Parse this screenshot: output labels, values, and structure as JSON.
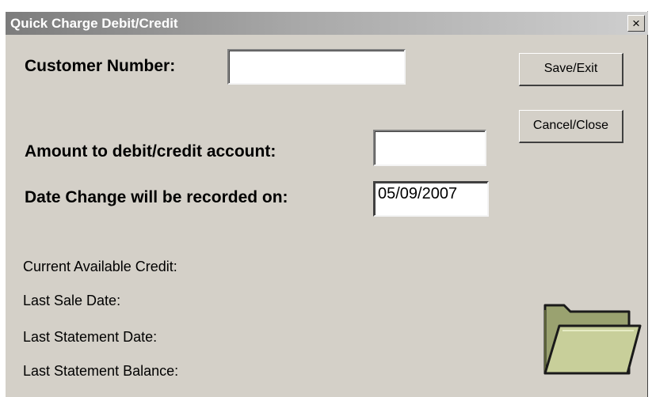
{
  "window": {
    "title": "Quick Charge Debit/Credit",
    "close_label": "×"
  },
  "form": {
    "customer_number_label": "Customer Number:",
    "customer_number_value": "",
    "amount_label": "Amount to debit/credit account:",
    "amount_value": "",
    "date_label": "Date Change will be recorded on:",
    "date_value": "05/09/2007"
  },
  "buttons": {
    "save_exit": "Save/Exit",
    "cancel_close": "Cancel/Close"
  },
  "info": {
    "current_available_credit_label": "Current Available Credit:",
    "last_sale_date_label": "Last Sale Date:",
    "last_statement_date_label": "Last Statement Date:",
    "last_statement_balance_label": "Last Statement Balance:"
  },
  "icons": {
    "close": "close-icon",
    "folder": "folder-icon"
  }
}
